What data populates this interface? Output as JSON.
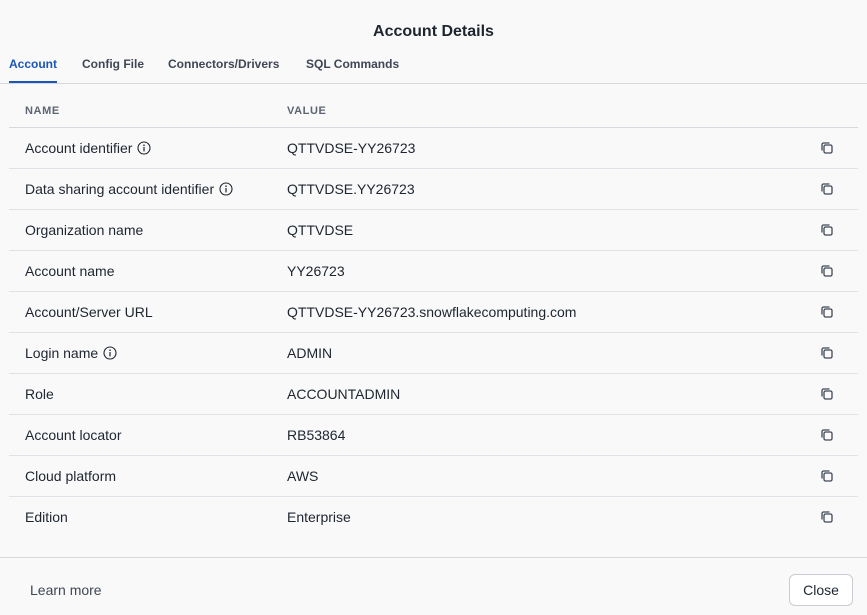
{
  "dialog": {
    "title": "Account Details"
  },
  "tabs": [
    {
      "label": "Account",
      "active": true
    },
    {
      "label": "Config File",
      "active": false
    },
    {
      "label": "Connectors/Drivers",
      "active": false
    },
    {
      "label": "SQL Commands",
      "active": false
    }
  ],
  "table": {
    "headers": {
      "name": "NAME",
      "value": "VALUE"
    },
    "rows": [
      {
        "name": "Account identifier",
        "value": "QTTVDSE-YY26723",
        "info": true
      },
      {
        "name": "Data sharing account identifier",
        "value": "QTTVDSE.YY26723",
        "info": true
      },
      {
        "name": "Organization name",
        "value": "QTTVDSE",
        "info": false
      },
      {
        "name": "Account name",
        "value": "YY26723",
        "info": false
      },
      {
        "name": "Account/Server URL",
        "value": "QTTVDSE-YY26723.snowflakecomputing.com",
        "info": false
      },
      {
        "name": "Login name",
        "value": "ADMIN",
        "info": true
      },
      {
        "name": "Role",
        "value": "ACCOUNTADMIN",
        "info": false
      },
      {
        "name": "Account locator",
        "value": "RB53864",
        "info": false
      },
      {
        "name": "Cloud platform",
        "value": "AWS",
        "info": false
      },
      {
        "name": "Edition",
        "value": "Enterprise",
        "info": false
      }
    ],
    "row_icons": {
      "info": "info-icon",
      "copy": "copy-icon"
    }
  },
  "footer": {
    "learn_more": "Learn more",
    "close_label": "Close"
  },
  "colors": {
    "accent": "#1a56b8",
    "background": "#f9f9fa",
    "text": "#1e252f"
  }
}
